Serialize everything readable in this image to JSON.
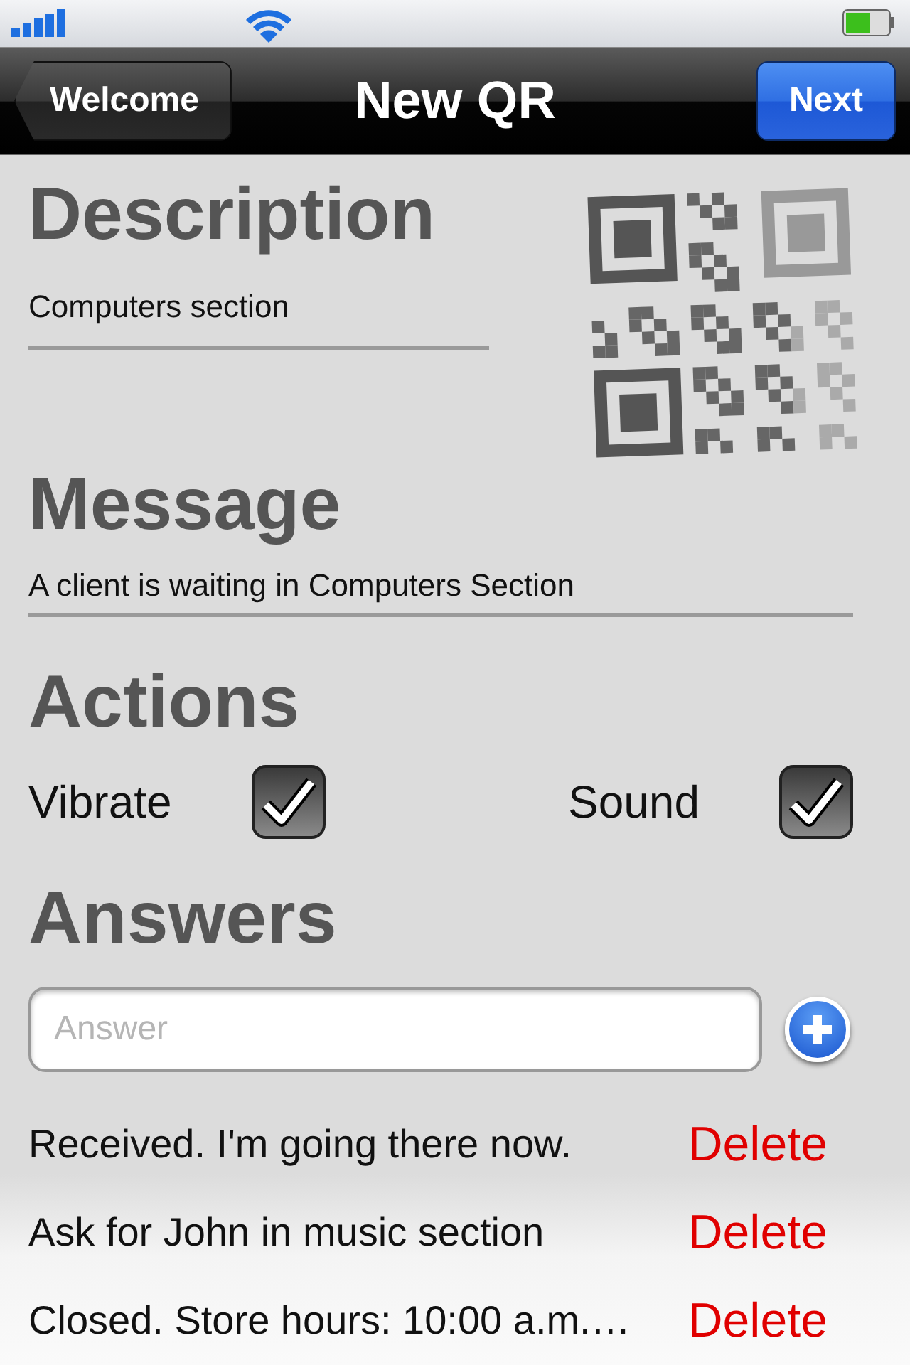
{
  "nav_bar": {
    "back_button": "Welcome",
    "title": "New QR",
    "next_button": "Next"
  },
  "description": {
    "heading": "Description",
    "value": "Computers section"
  },
  "qr_code": {
    "kind": "qr"
  },
  "message": {
    "heading": "Message",
    "value": "A client is waiting in Computers Section"
  },
  "actions": {
    "heading": "Actions",
    "options": [
      {
        "label": "Vibrate",
        "checked": true
      },
      {
        "label": "Sound",
        "checked": true
      }
    ]
  },
  "answers": {
    "heading": "Answers",
    "placeholder": "Answer",
    "items": [
      {
        "text": "Received. I'm going there now.",
        "action": "Delete"
      },
      {
        "text": "Ask for John in music section",
        "action": "Delete"
      },
      {
        "text": "Closed. Store hours: 10:00 a.m.…",
        "action": "Delete"
      }
    ]
  }
}
